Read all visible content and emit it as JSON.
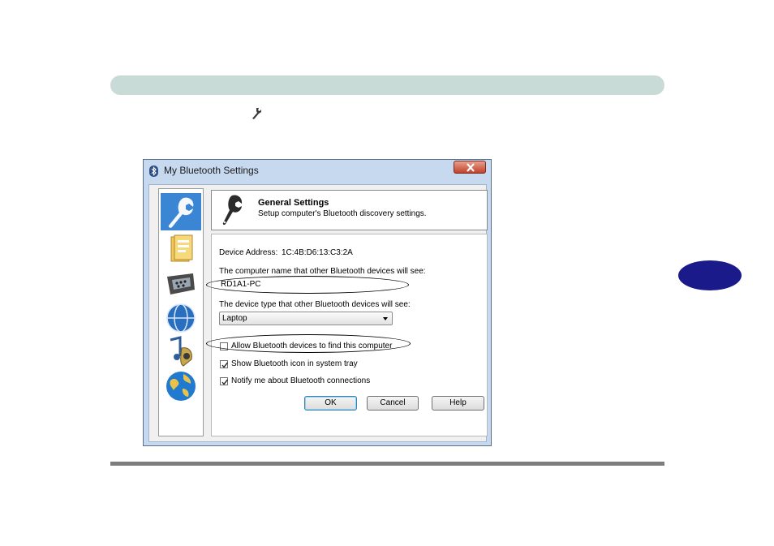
{
  "dialog": {
    "title": "My Bluetooth Settings",
    "header": {
      "title": "General Settings",
      "subtitle": "Setup computer's Bluetooth discovery settings."
    },
    "device_address_label": "Device Address:",
    "device_address_value": "1C:4B:D6:13:C3:2A",
    "computer_name_label": "The computer name that other Bluetooth devices will see:",
    "computer_name_value": "RD1A1-PC",
    "device_type_label": "The device type that other Bluetooth devices will see:",
    "device_type_value": "Laptop",
    "checkboxes": [
      {
        "label": "Allow Bluetooth devices to find this computer",
        "checked": false
      },
      {
        "label": "Show Bluetooth icon in system tray",
        "checked": true
      },
      {
        "label": "Notify me about Bluetooth connections",
        "checked": true
      }
    ],
    "buttons": {
      "ok": "OK",
      "cancel": "Cancel",
      "help": "Help"
    },
    "sidebar_icons": [
      "wrench-icon",
      "folder-icon",
      "serial-port-icon",
      "network-globe-icon",
      "music-icon",
      "globe-icon"
    ]
  },
  "colors": {
    "header_bar": "#c9dbd6",
    "side_tab": "#1a1a8a",
    "footer_line": "#7d7d7d",
    "selected_icon_bg": "#3a86d4",
    "dialog_frame": "#c7d9ee"
  }
}
